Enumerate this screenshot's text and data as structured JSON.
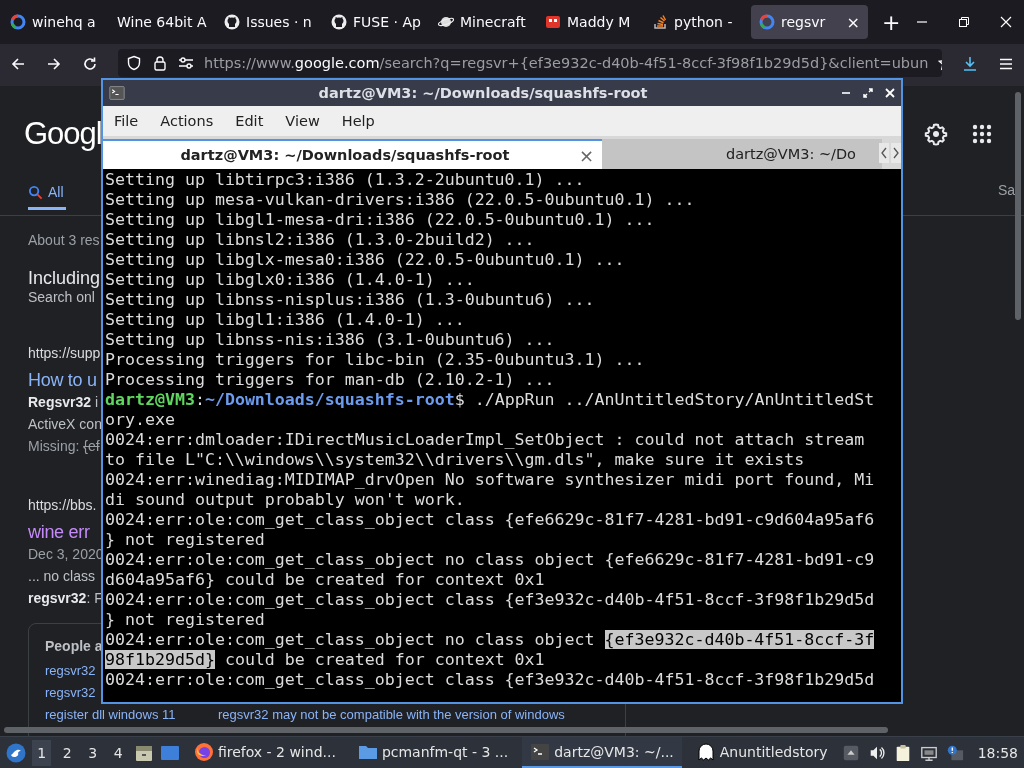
{
  "browser": {
    "tabs": [
      {
        "label": "winehq a",
        "kind": "ring",
        "selected": false
      },
      {
        "label": "Wine 64bit A",
        "kind": "plain",
        "selected": false
      },
      {
        "label": "Issues · n",
        "kind": "cat",
        "selected": false
      },
      {
        "label": "FUSE · Ap",
        "kind": "cat",
        "selected": false
      },
      {
        "label": "Minecraft",
        "kind": "planet",
        "selected": false
      },
      {
        "label": "Maddy M",
        "kind": "red",
        "selected": false
      },
      {
        "label": "python - ",
        "kind": "stack",
        "selected": false
      },
      {
        "label": "regsvr",
        "kind": "ring",
        "selected": true,
        "close": "×"
      }
    ],
    "new_tab": "+",
    "url": {
      "scheme": "https://www.",
      "host": "google.com",
      "path": "/search?q=regsvr+{ef3e932c-d40b-4f51-8ccf-3f98f1b29d5d}&client=ubun"
    }
  },
  "google": {
    "logo": "Googl",
    "nav_tabs": [
      {
        "label": "All",
        "selected": true
      }
    ],
    "side_label": "Sa",
    "result_stats": "About 3 res",
    "notice": {
      "title": "Including",
      "subtitle": "Search onl"
    },
    "results": [
      {
        "url": "https://supp",
        "title": "How to u",
        "visited": false,
        "snippet": [
          "**Regsvr32** i",
          "ActiveX con"
        ],
        "missing": {
          "label": "Missing:",
          "term": "{ef"
        }
      },
      {
        "url": "https://bbs.",
        "title": "wine err",
        "visited": true,
        "date": "Dec 3, 2020",
        "snippet": [
          "... no class",
          "**regsvr32**: F"
        ]
      }
    ],
    "people_also_ask": {
      "title": "People a",
      "rows": [
        {
          "query": "regsvr32"
        },
        {
          "query": "regsvr32"
        },
        {
          "query": "register dll windows 11",
          "answer": "regsvr32 may not be compatible with the version of windows"
        }
      ]
    }
  },
  "terminal": {
    "title": "dartz@VM3: ~/Downloads/squashfs-root",
    "menu": [
      "File",
      "Actions",
      "Edit",
      "View",
      "Help"
    ],
    "tabs": [
      {
        "label": "dartz@VM3: ~/Downloads/squashfs-root",
        "selected": true,
        "close": "×"
      },
      {
        "label": "dartz@VM3: ~/Do",
        "selected": false
      }
    ],
    "lines": [
      [
        {
          "kind": "text",
          "text": "Setting up libtirpc3:i386 (1.3.2-2ubuntu0.1) ..."
        }
      ],
      [
        {
          "kind": "text",
          "text": "Setting up mesa-vulkan-drivers:i386 (22.0.5-0ubuntu0.1) ..."
        }
      ],
      [
        {
          "kind": "text",
          "text": "Setting up libgl1-mesa-dri:i386 (22.0.5-0ubuntu0.1) ..."
        }
      ],
      [
        {
          "kind": "text",
          "text": "Setting up libnsl2:i386 (1.3.0-2build2) ..."
        }
      ],
      [
        {
          "kind": "text",
          "text": "Setting up libglx-mesa0:i386 (22.0.5-0ubuntu0.1) ..."
        }
      ],
      [
        {
          "kind": "text",
          "text": "Setting up libglx0:i386 (1.4.0-1) ..."
        }
      ],
      [
        {
          "kind": "text",
          "text": "Setting up libnss-nisplus:i386 (1.3-0ubuntu6) ..."
        }
      ],
      [
        {
          "kind": "text",
          "text": "Setting up libgl1:i386 (1.4.0-1) ..."
        }
      ],
      [
        {
          "kind": "text",
          "text": "Setting up libnss-nis:i386 (3.1-0ubuntu6) ..."
        }
      ],
      [
        {
          "kind": "text",
          "text": "Processing triggers for libc-bin (2.35-0ubuntu3.1) ..."
        }
      ],
      [
        {
          "kind": "text",
          "text": "Processing triggers for man-db (2.10.2-1) ..."
        }
      ],
      [
        {
          "kind": "user",
          "text": "dartz@VM3"
        },
        {
          "kind": "text",
          "text": ":"
        },
        {
          "kind": "path",
          "text": "~/Downloads/squashfs-root"
        },
        {
          "kind": "text",
          "text": "$ ./AppRun ../AnUntitledStory/AnUntitledSt"
        }
      ],
      [
        {
          "kind": "text",
          "text": "ory.exe"
        }
      ],
      [
        {
          "kind": "text",
          "text": "0024:err:dmloader:IDirectMusicLoaderImpl_SetObject : could not attach stream"
        }
      ],
      [
        {
          "kind": "text",
          "text": "to file L\"C:\\\\windows\\\\system32\\\\drivers\\\\gm.dls\", make sure it exists"
        }
      ],
      [
        {
          "kind": "text",
          "text": "0024:err:winediag:MIDIMAP_drvOpen No software synthesizer midi port found, Mi"
        }
      ],
      [
        {
          "kind": "text",
          "text": "di sound output probably won't work."
        }
      ],
      [
        {
          "kind": "text",
          "text": "0024:err:ole:com_get_class_object class {efe6629c-81f7-4281-bd91-c9d604a95af6"
        }
      ],
      [
        {
          "kind": "text",
          "text": "} not registered"
        }
      ],
      [
        {
          "kind": "text",
          "text": "0024:err:ole:com_get_class_object no class object {efe6629c-81f7-4281-bd91-c9"
        }
      ],
      [
        {
          "kind": "text",
          "text": "d604a95af6} could be created for context 0x1"
        }
      ],
      [
        {
          "kind": "text",
          "text": "0024:err:ole:com_get_class_object class {ef3e932c-d40b-4f51-8ccf-3f98f1b29d5d"
        }
      ],
      [
        {
          "kind": "text",
          "text": "} not registered"
        }
      ],
      [
        {
          "kind": "text",
          "text": "0024:err:ole:com_get_class_object no class object "
        },
        {
          "kind": "selection",
          "text": "{ef3e932c-d40b-4f51-8ccf-3f"
        }
      ],
      [
        {
          "kind": "selection",
          "text": "98f1b29d5d}"
        },
        {
          "kind": "text",
          "text": " could be created for context 0x1"
        }
      ],
      [
        {
          "kind": "text",
          "text": "0024:err:ole:com_get_class_object class {ef3e932c-d40b-4f51-8ccf-3f98f1b29d5d"
        }
      ]
    ]
  },
  "taskbar": {
    "workspaces": [
      {
        "label": "1",
        "selected": true
      },
      {
        "label": "2",
        "selected": false
      },
      {
        "label": "3",
        "selected": false
      },
      {
        "label": "4",
        "selected": false
      }
    ],
    "tasks": [
      {
        "label": "firefox - 2 wind...",
        "kind": "fox",
        "selected": false
      },
      {
        "label": "pcmanfm-qt - 3 ...",
        "kind": "folder",
        "selected": false
      },
      {
        "label": "dartz@VM3: ~/...",
        "kind": "terminal",
        "selected": true
      },
      {
        "label": "Anuntitledstory",
        "kind": "ghost",
        "selected": false
      }
    ],
    "clock": "18:58"
  }
}
